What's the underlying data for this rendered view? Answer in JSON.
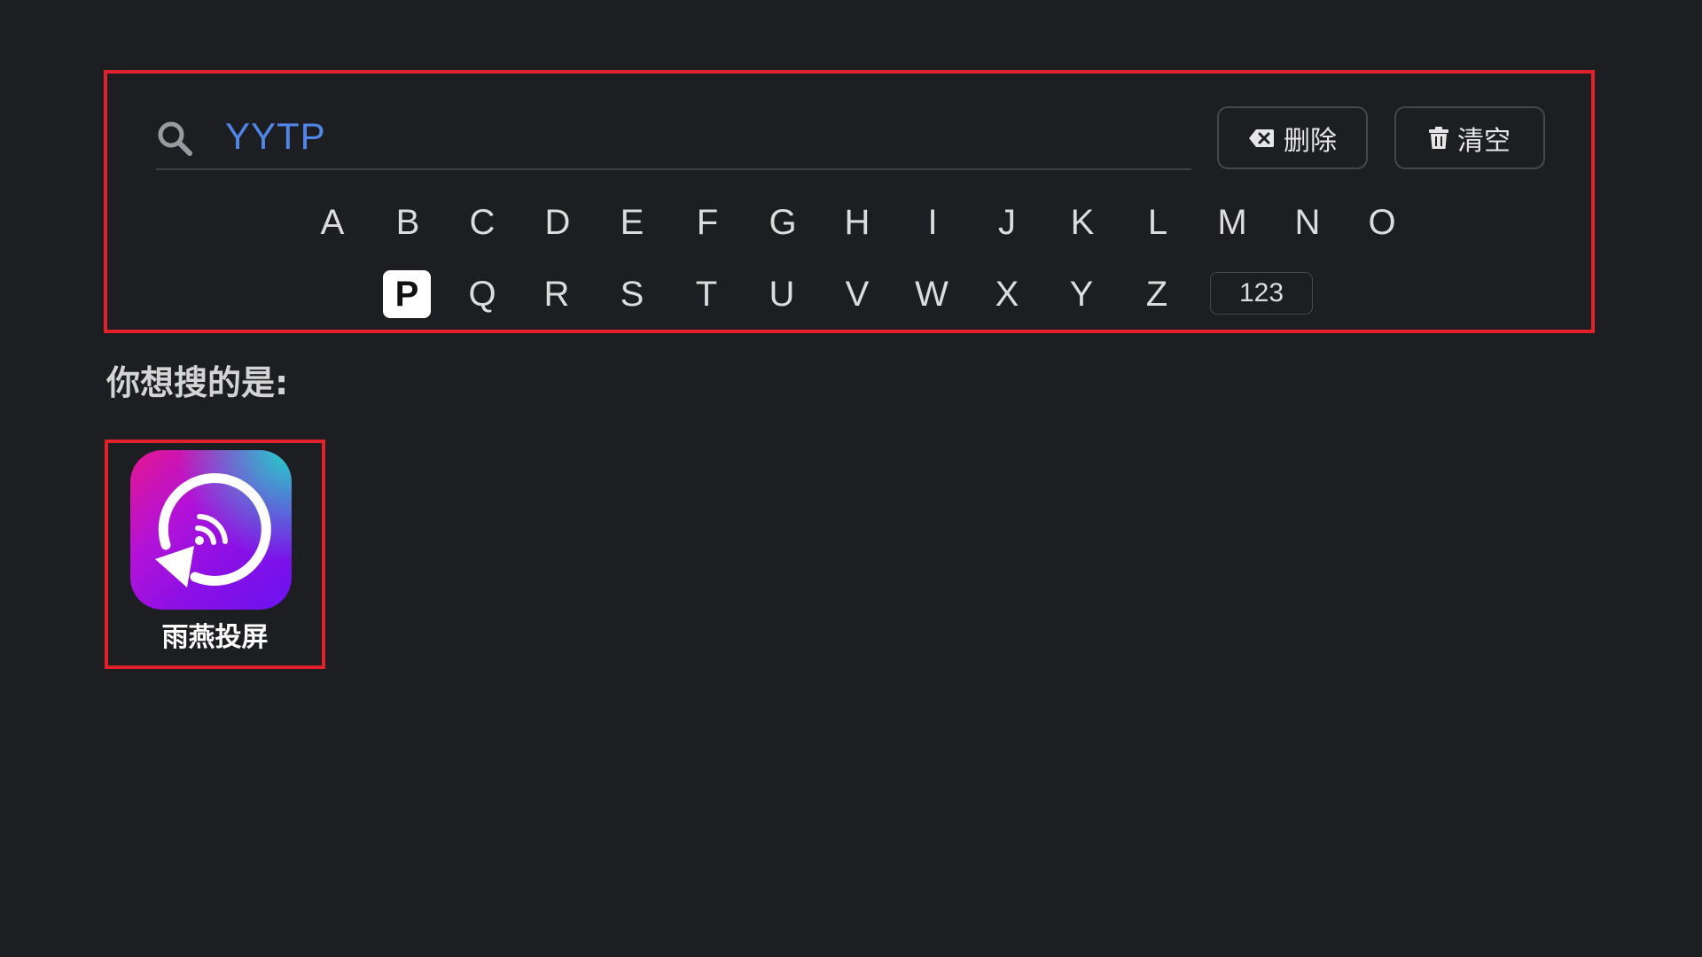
{
  "search": {
    "query": "YYTP",
    "delete_label": "删除",
    "clear_label": "清空",
    "icons": {
      "search": "search-icon",
      "delete": "backspace-icon",
      "clear": "trash-icon"
    }
  },
  "keyboard": {
    "row1": [
      "A",
      "B",
      "C",
      "D",
      "E",
      "F",
      "G",
      "H",
      "I",
      "J",
      "K",
      "L",
      "M",
      "N",
      "O"
    ],
    "row2": [
      "P",
      "Q",
      "R",
      "S",
      "T",
      "U",
      "V",
      "W",
      "X",
      "Y",
      "Z"
    ],
    "numeric_label": "123",
    "selected_key": "P"
  },
  "suggestions": {
    "title": "你想搜的是:",
    "apps": [
      {
        "name": "雨燕投屏",
        "icon": "screen-cast-app-icon"
      }
    ]
  },
  "colors": {
    "background": "#1d1e22",
    "highlight_border": "#e0202a",
    "query_text": "#4f86e8",
    "button_border": "#45474d"
  }
}
